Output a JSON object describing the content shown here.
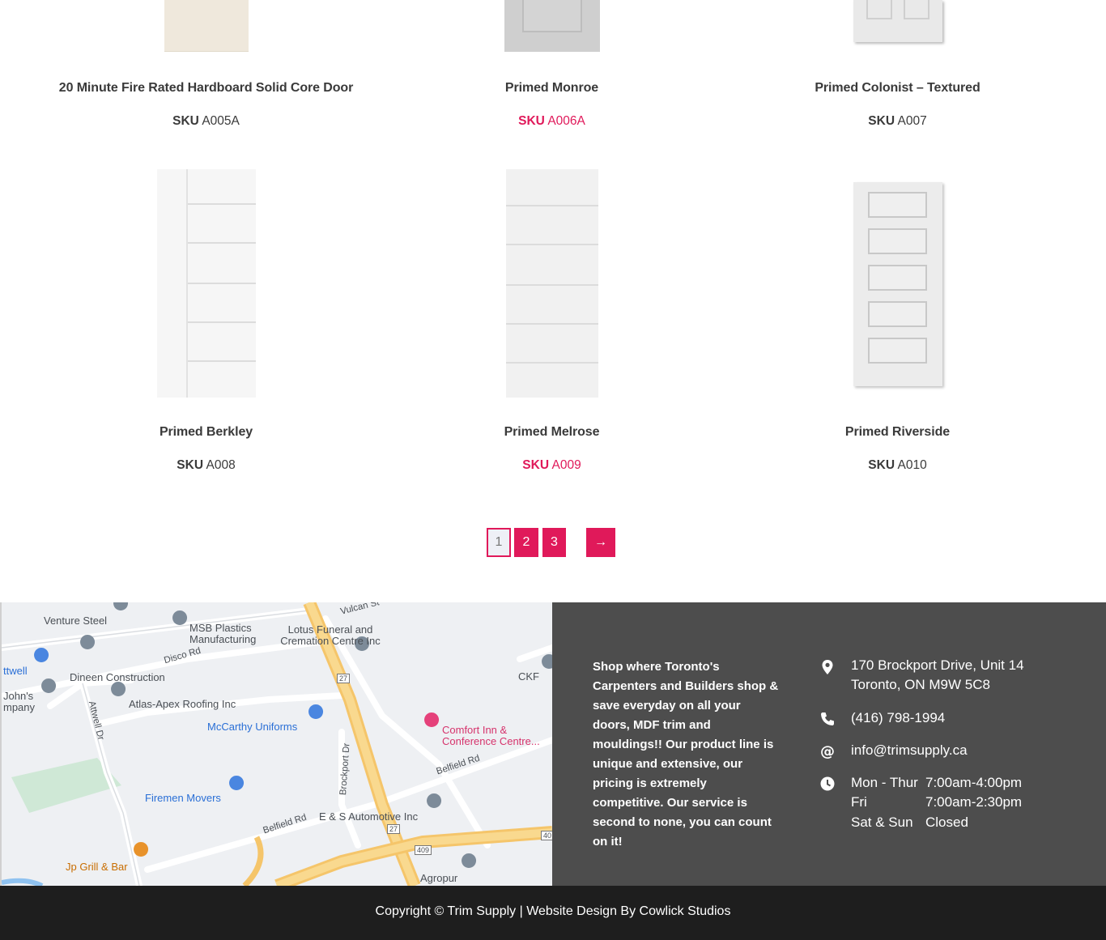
{
  "products": [
    {
      "title": "20 Minute Fire Rated Hardboard Solid Core Door",
      "sku_label": "SKU",
      "sku": "A005A"
    },
    {
      "title": "Primed Monroe",
      "sku_label": "SKU",
      "sku": "A006A"
    },
    {
      "title": "Primed Colonist – Textured",
      "sku_label": "SKU",
      "sku": "A007"
    },
    {
      "title": "Primed Berkley",
      "sku_label": "SKU",
      "sku": "A008"
    },
    {
      "title": "Primed Melrose",
      "sku_label": "SKU",
      "sku": "A009"
    },
    {
      "title": "Primed Riverside",
      "sku_label": "SKU",
      "sku": "A010"
    }
  ],
  "pagination": {
    "pages": [
      "1",
      "2",
      "3"
    ],
    "current": "1",
    "next": "→"
  },
  "map": {
    "labels": [
      "Venture Steel",
      "MSB Plastics Manufacturing",
      "Lotus Funeral and Cremation Centre Inc",
      "Disco Rd",
      "ttwell",
      "Dineen Construction",
      "John's mpany",
      "Atlas-Apex Roofing Inc",
      "McCarthy Uniforms",
      "Comfort Inn & Conference Centre...",
      "CKF",
      "Attwell Dr",
      "Brockport Dr",
      "Belfield Rd",
      "Firemen Movers",
      "E & S Automotive Inc",
      "Jp Grill & Bar",
      "Agropur",
      "Vulcan St",
      "27",
      "409",
      "40"
    ]
  },
  "footer": {
    "blurb": "Shop where Toronto's Carpenters and Builders shop & save everyday on all your doors, MDF trim and mouldings!! Our product line is unique and extensive, our pricing is extremely competitive. Our service is second to none, you can count on it!",
    "address_line1": "170 Brockport Drive, Unit 14",
    "address_line2": "Toronto, ON M9W 5C8",
    "phone": "(416) 798-1994",
    "email": "info@trimsupply.ca",
    "hours": [
      {
        "day": "Mon - Thur",
        "time": "7:00am-4:00pm"
      },
      {
        "day": "Fri",
        "time": "7:00am-2:30pm"
      },
      {
        "day": "Sat & Sun",
        "time": "Closed"
      }
    ],
    "icons": [
      "map-pin-icon",
      "phone-icon",
      "at-icon",
      "clock-icon"
    ],
    "copyright": "Copyright © Trim Supply | Website Design By Cowlick Studios"
  },
  "colors": {
    "accent": "#e0195a",
    "footer_bg": "#4d4d4d",
    "bottom_bg": "#1e1e1e"
  }
}
